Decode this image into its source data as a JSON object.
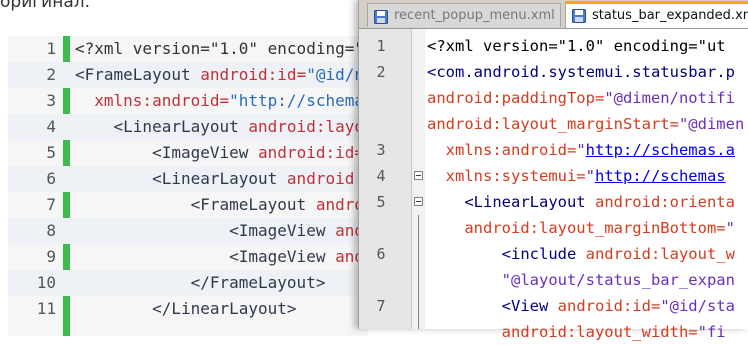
{
  "page": {
    "top_text": "оригинал."
  },
  "left_code": {
    "lines": [
      {
        "num": "1",
        "segs": [
          {
            "t": "<?xml version=\"1.0\" encoding=\"",
            "c": "c-dk"
          }
        ]
      },
      {
        "num": "2",
        "segs": [
          {
            "t": "<FrameLayout ",
            "c": "c-tg"
          },
          {
            "t": "android:id=",
            "c": "c-kw"
          },
          {
            "t": "\"@id/n",
            "c": "c-st"
          }
        ]
      },
      {
        "num": "3",
        "segs": [
          {
            "t": "  xmlns:android=",
            "c": "c-kw"
          },
          {
            "t": "\"http://schema",
            "c": "c-st"
          }
        ]
      },
      {
        "num": "4",
        "segs": [
          {
            "t": "    <LinearLayout ",
            "c": "c-tg"
          },
          {
            "t": "android:layo",
            "c": "c-kw"
          }
        ]
      },
      {
        "num": "5",
        "segs": [
          {
            "t": "        <ImageView ",
            "c": "c-tg"
          },
          {
            "t": "android:id=",
            "c": "c-kw"
          }
        ]
      },
      {
        "num": "6",
        "segs": [
          {
            "t": "        <LinearLayout ",
            "c": "c-tg"
          },
          {
            "t": "android:",
            "c": "c-kw"
          }
        ]
      },
      {
        "num": "7",
        "segs": [
          {
            "t": "            <FrameLayout ",
            "c": "c-tg"
          },
          {
            "t": "andro",
            "c": "c-kw"
          }
        ]
      },
      {
        "num": "8",
        "segs": [
          {
            "t": "                <ImageView ",
            "c": "c-tg"
          },
          {
            "t": "and",
            "c": "c-kw"
          }
        ]
      },
      {
        "num": "9",
        "segs": [
          {
            "t": "                <ImageView ",
            "c": "c-tg"
          },
          {
            "t": "and",
            "c": "c-kw"
          }
        ]
      },
      {
        "num": "10",
        "segs": [
          {
            "t": "            </FrameLayout>",
            "c": "c-tg"
          }
        ]
      },
      {
        "num": "11",
        "segs": [
          {
            "t": "        </LinearLayout>",
            "c": "c-tg"
          }
        ]
      }
    ]
  },
  "editor": {
    "tabs": [
      {
        "label": "recent_popup_menu.xml",
        "active": false
      },
      {
        "label": "status_bar_expanded.xml",
        "active": true
      }
    ],
    "lines": [
      {
        "num": "1",
        "segs": [
          {
            "t": "<?xml version=\"1.0\" encoding=\"ut",
            "c": "e-dk"
          }
        ]
      },
      {
        "num": "2",
        "segs": [
          {
            "t": "<com.android.systemui.statusbar.p",
            "c": "e-tg"
          }
        ]
      },
      {
        "num": "",
        "segs": [
          {
            "t": "android:paddingTop=",
            "c": "e-at"
          },
          {
            "t": "\"@dimen/notifi",
            "c": "e-st"
          }
        ]
      },
      {
        "num": "",
        "segs": [
          {
            "t": "android:layout_marginStart=",
            "c": "e-at"
          },
          {
            "t": "\"@dimen",
            "c": "e-st"
          }
        ]
      },
      {
        "num": "3",
        "segs": [
          {
            "t": "  xmlns:android=",
            "c": "e-at"
          },
          {
            "t": "\"",
            "c": "e-st"
          },
          {
            "t": "http://schemas.a",
            "c": "e-ln"
          }
        ]
      },
      {
        "num": "4",
        "segs": [
          {
            "t": "  xmlns:systemui=",
            "c": "e-at"
          },
          {
            "t": "\"",
            "c": "e-st"
          },
          {
            "t": "http://schemas",
            "c": "e-ln"
          }
        ]
      },
      {
        "num": "5",
        "segs": [
          {
            "t": "    <LinearLayout ",
            "c": "e-tg"
          },
          {
            "t": "android:orienta",
            "c": "e-at"
          }
        ]
      },
      {
        "num": "",
        "segs": [
          {
            "t": "    android:layout_marginBottom=",
            "c": "e-at"
          },
          {
            "t": "\"",
            "c": "e-st"
          }
        ]
      },
      {
        "num": "6",
        "segs": [
          {
            "t": "        <include ",
            "c": "e-tg"
          },
          {
            "t": "android:layout_w",
            "c": "e-at"
          }
        ]
      },
      {
        "num": "",
        "segs": [
          {
            "t": "        \"@layout/status_bar_expan",
            "c": "e-st"
          }
        ]
      },
      {
        "num": "7",
        "segs": [
          {
            "t": "        <View ",
            "c": "e-tg"
          },
          {
            "t": "android:id=",
            "c": "e-at"
          },
          {
            "t": "\"@id/sta",
            "c": "e-st"
          }
        ]
      },
      {
        "num": "",
        "segs": [
          {
            "t": "        android:layout_width=",
            "c": "e-at"
          },
          {
            "t": "\"fi",
            "c": "e-st"
          }
        ]
      }
    ]
  },
  "colors": {
    "green_bar": "#3dbb4c",
    "active_tab_accent": "#f5a623",
    "xml_attr": "#d63b1e",
    "xml_string": "#6b2fbf"
  },
  "icons": {
    "tab_file": "floppy-disk-icon"
  }
}
